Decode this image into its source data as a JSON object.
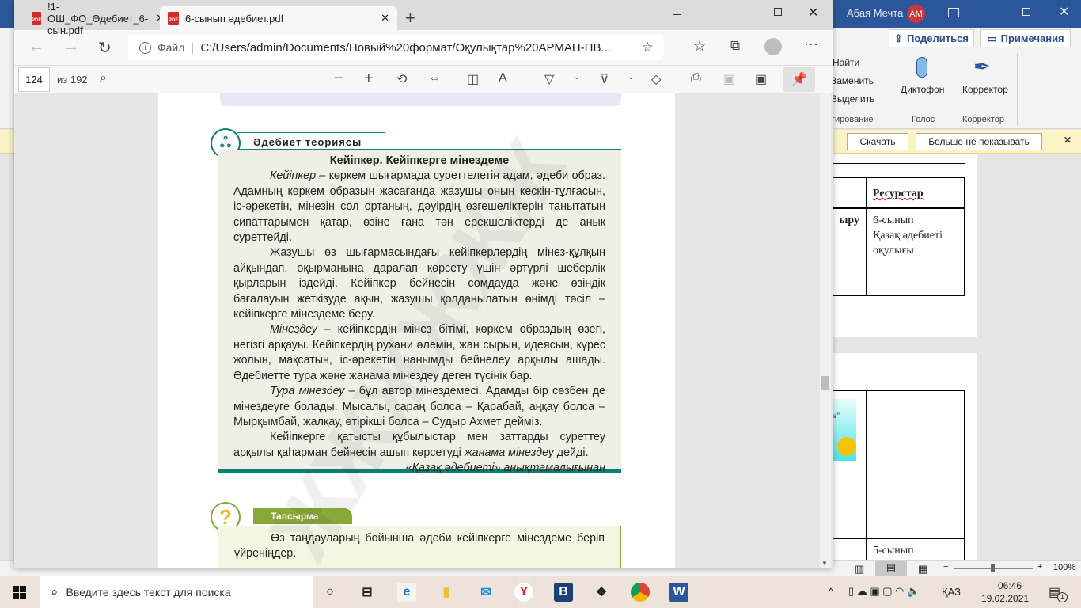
{
  "word": {
    "user_name": "Абая Мечта",
    "user_initials": "AM",
    "share_label": "Поделиться",
    "comments_label": "Примечания",
    "editing": {
      "find": "Найти",
      "replace": "Заменить",
      "select": "Выделить",
      "group": "ктирование"
    },
    "voice": {
      "dictate": "Диктофон",
      "group": "Голос"
    },
    "editor": {
      "label": "Корректор",
      "group": "Корректор"
    },
    "notice": {
      "download": "Скачать",
      "dont_show": "Больше не показывать"
    },
    "table": {
      "header_resources": "Ресурстар",
      "row1_left": "ыру",
      "row1_resources": [
        "6-сынып",
        "Қазақ әдебиеті",
        "оқулығы"
      ],
      "image_caption": "лак\"",
      "row3_resources": "5-сынып"
    },
    "zoom": "100%",
    "zoom_level_percent": 100
  },
  "edge": {
    "tabs": [
      {
        "title": "!1-ОШ_ФО_Әдебиет_6-сын.pdf",
        "active": false
      },
      {
        "title": "6-сынып әдебиет.pdf",
        "active": true
      }
    ],
    "address": {
      "scheme_label": "Файл",
      "url": "C:/Users/admin/Documents/Новый%20формат/Оқулықтар%20АРМАН-ПВ..."
    },
    "pdf_toolbar": {
      "page": "124",
      "total": "из 192"
    }
  },
  "pdf": {
    "section_title": "Әдебиет теориясы",
    "heading": "Кейіпкер. Кейіпкерге мінездеме",
    "paragraphs": [
      {
        "term": "Кейіпкер",
        "text": " – көркем шығармада суреттелетін адам, әдеби образ. Адамның көркем образын жасағанда жазушы оның кескін-тұлғасын, іс-әрекетін, мінезін сол ортаның, дәуірдің өзгешеліктерін танытатын сипаттарымен қатар, өзіне ғана тән ерекшеліктерді де анық суреттейді."
      },
      {
        "term": "",
        "text": "Жазушы өз шығармасындағы кейіпкерлердің мінез-құлқын айқындап, оқырманына даралап көрсету үшін әртүрлі шеберлік қырларын іздейді. Кейіпкер бейнесін сомдауда және өзіндік бағалауын жеткізуде ақын, жазушы қолданылатын өнімді тәсіл – кейіпкерге мінездеме беру."
      },
      {
        "term": "Мінездеу",
        "text": " – кейіпкердің мінез бітімі, көркем образдың өзегі, негізгі арқауы. Кейіпкердің рухани әлемін, жан сырын, идеясын, күрес жолын, мақсатын, іс-әрекетін нанымды бейнелеу арқылы ашады. Әдебиетте тура және жанама мінездеу деген түсінік бар."
      },
      {
        "term": "Тура мінездеу",
        "text": " – бұл автор мінездемесі. Адамды бір сөзбен де мінездеуге болады. Мысалы, сараң болса – Қарабай, аңқау болса – Мырқымбай, жалқау, өтірікші болса – Судыр Ахмет дейміз."
      }
    ],
    "last_paragraph": {
      "before": "Кейіпкерге қатысты құбылыстар мен заттарды суреттеу арқылы қаһарман бейнесін ашып көрсетуді ",
      "term": "жанама мінездеу",
      "after": " дейді."
    },
    "source": "«Қазақ әдебиеті» анықтамалығынан",
    "task_title": "Тапсырма",
    "task_text": "Өз таңдауларың бойынша әдеби кейіпкерге мінездеме беріп үйреніңдер.",
    "colors": {
      "teal": "#0d7f6f",
      "green": "#8aa83a",
      "box_bg": "#eef0e6",
      "task_bg": "#f2f6e3"
    }
  },
  "taskbar": {
    "search_placeholder": "Введите здесь текст для поиска",
    "lang": "ҚАЗ",
    "time": "06:46",
    "date": "19.02.2021",
    "notifications": "1"
  }
}
